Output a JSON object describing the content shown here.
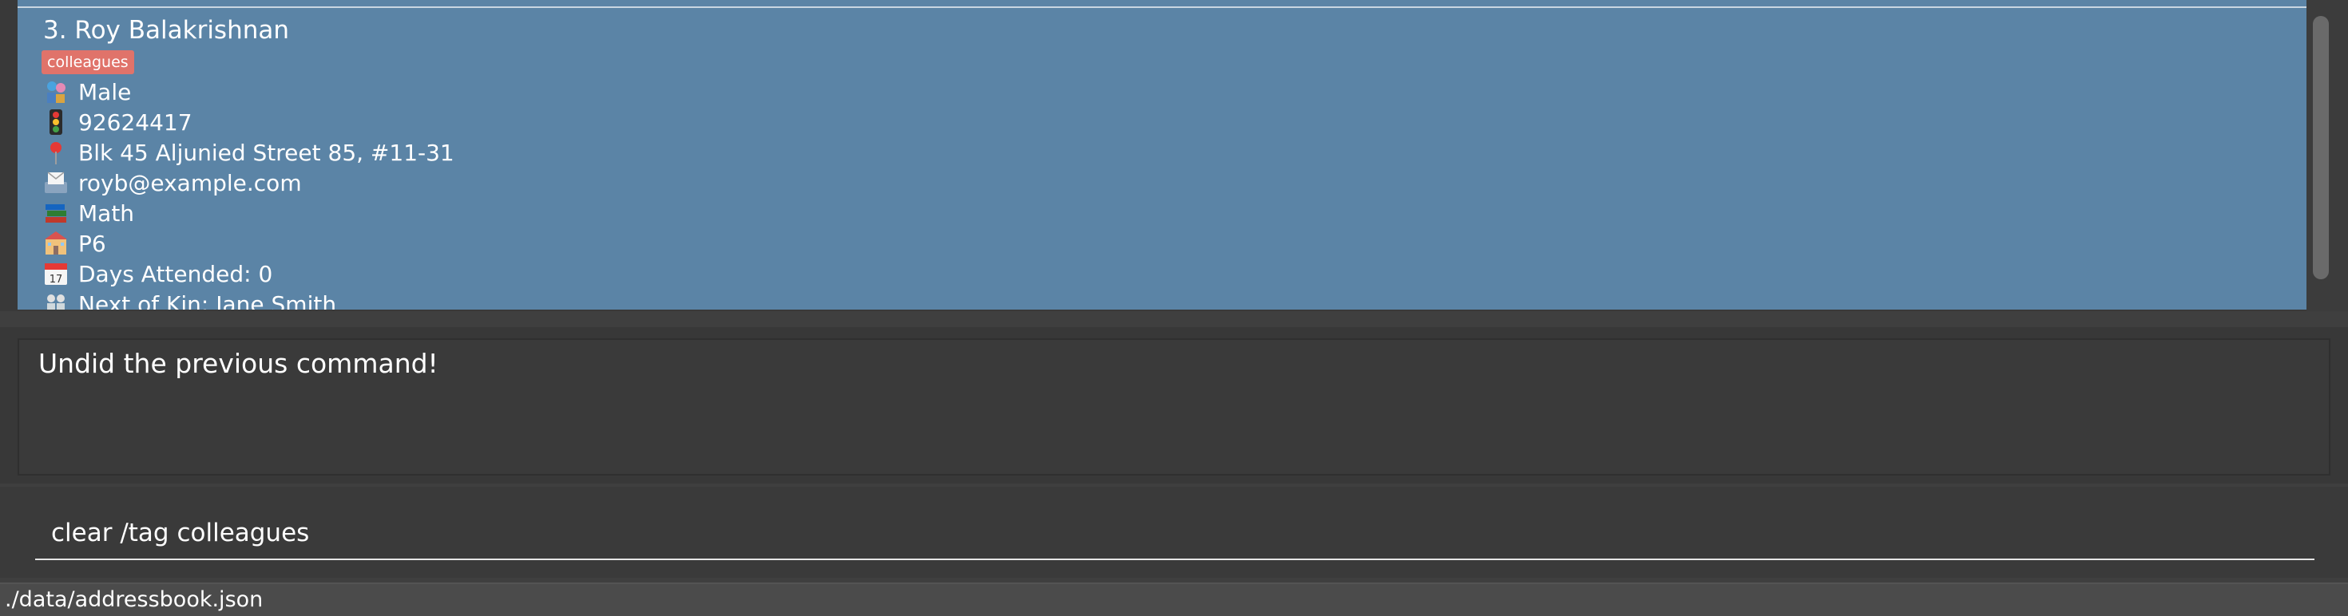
{
  "person_list": {
    "selected_person": {
      "index_name": "3. Roy Balakrishnan",
      "tags": [
        "colleagues"
      ],
      "fields": {
        "gender": "Male",
        "phone": "92624417",
        "address": "Blk 45 Aljunied Street 85, #11-31",
        "email": "royb@example.com",
        "subject": "Math",
        "level": "P6",
        "days_attended": "Days Attended: 0",
        "next_of_kin": "Next of Kin: Jane Smith"
      },
      "icons": {
        "gender": "gender-icon",
        "phone": "traffic-light-phone-icon",
        "address": "location-pin-icon",
        "email": "email-tray-icon",
        "subject": "books-icon",
        "level": "school-building-icon",
        "days_attended": "calendar-icon",
        "next_of_kin": "family-icon"
      }
    }
  },
  "result_display": {
    "message": "Undid the previous command!"
  },
  "command_box": {
    "value": "clear /tag colleagues"
  },
  "status_bar": {
    "save_location": "./data/addressbook.json"
  },
  "colors": {
    "selected_card": "#5b84a6",
    "tag": "#e0736a",
    "background": "#3f3f3f"
  }
}
